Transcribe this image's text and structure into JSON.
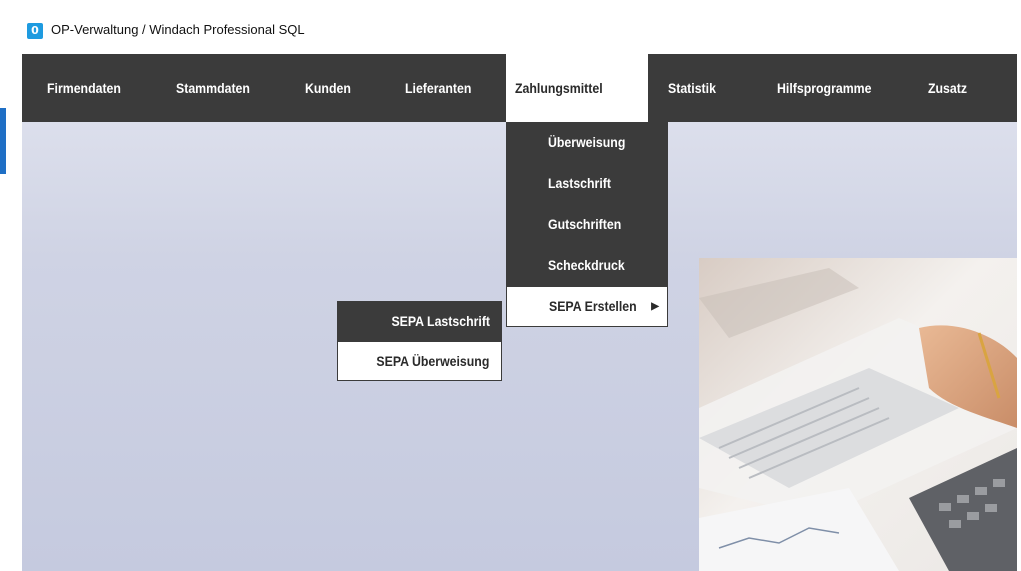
{
  "window": {
    "title": "OP-Verwaltung / Windach Professional SQL",
    "icon": "app-icon"
  },
  "menubar": {
    "items": [
      {
        "label": "Firmendaten"
      },
      {
        "label": "Stammdaten"
      },
      {
        "label": "Kunden"
      },
      {
        "label": "Lieferanten"
      },
      {
        "label": "Zahlungsmittel"
      },
      {
        "label": "Statistik"
      },
      {
        "label": "Hilfsprogramme"
      },
      {
        "label": "Zusatz"
      }
    ],
    "active": "Zahlungsmittel"
  },
  "dropdown": {
    "items": [
      {
        "label": "Überweisung"
      },
      {
        "label": "Lastschrift"
      },
      {
        "label": "Gutschriften"
      },
      {
        "label": "Scheckdruck"
      },
      {
        "label": "SEPA Erstellen",
        "arrow": "▶"
      }
    ],
    "highlighted": "SEPA Erstellen"
  },
  "submenu": {
    "items": [
      {
        "label": "SEPA Lastschrift"
      },
      {
        "label": "SEPA Überweisung"
      }
    ]
  },
  "colors": {
    "menubar": "#3b3b3b",
    "background": "#cfd3e4",
    "accent": "#1f6fc5"
  }
}
